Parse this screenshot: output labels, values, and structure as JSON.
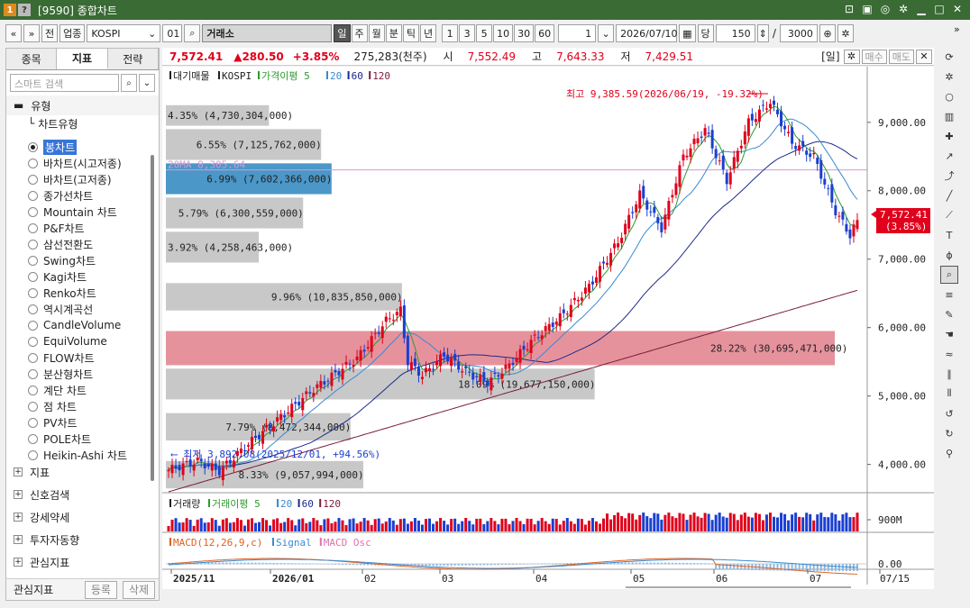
{
  "window": {
    "badge1": "1",
    "badge2": "?",
    "title": "[9590] 종합차트"
  },
  "toolbar": {
    "nav_prev": "«",
    "nav_down": "»",
    "btn_full": "전",
    "btn_sector": "업종",
    "symbol": "KOSPI",
    "code": "01",
    "market": "거래소",
    "periods": [
      "일",
      "주",
      "월",
      "분",
      "틱",
      "년"
    ],
    "selected_period": "일",
    "nums": [
      "1",
      "3",
      "5",
      "10",
      "30",
      "60"
    ],
    "interval": "1",
    "date": "2026/07/10",
    "btn_dang": "당",
    "count": "150",
    "slash": "/",
    "total": "3000"
  },
  "left_panel": {
    "tabs": [
      "종목",
      "지표",
      "전략"
    ],
    "active_tab": "지표",
    "search_placeholder": "스마트 검색",
    "tree_head": "유형",
    "tree_sub": "차트유형",
    "chart_types": [
      "봉차트",
      "바차트(시고저종)",
      "바차트(고저종)",
      "종가선차트",
      "Mountain 차트",
      "P&F차트",
      "삼선전환도",
      "Swing차트",
      "Kagi차트",
      "Renko차트",
      "역시계곡선",
      "CandleVolume",
      "EquiVolume",
      "FLOW차트",
      "분산형차트",
      "계단 차트",
      "점 차트",
      "PV차트",
      "POLE차트",
      "Heikin-Ashi 차트"
    ],
    "selected_type": "봉차트",
    "groups": [
      "지표",
      "신호검색",
      "강세약세",
      "투자자동향",
      "관심지표"
    ],
    "bottom_label": "관심지표",
    "btn_register": "등록",
    "btn_delete": "삭제"
  },
  "price_bar": {
    "price": "7,572.41",
    "change": "▲280.50",
    "pct": "+3.85%",
    "volume": "275,283(천주)",
    "open_label": "시",
    "open": "7,552.49",
    "high_label": "고",
    "high": "7,643.33",
    "low_label": "저",
    "low": "7,429.51",
    "period_tag": "[일]",
    "btn_buy": "매수",
    "btn_sell": "매도"
  },
  "chart_data": {
    "type": "candlestick",
    "legend": {
      "l1": "대기매물",
      "l2": "KOSPI",
      "l3": "가격이평 5",
      "l4": "20",
      "l5": "60",
      "l6": "120"
    },
    "y_ticks": [
      "9,000.00",
      "8,000.00",
      "7,000.00",
      "6,000.00",
      "5,000.00",
      "4,000.00"
    ],
    "y_range": [
      3600,
      9550
    ],
    "x_ticks": [
      "2025/11",
      "2026/01",
      "02",
      "03",
      "04",
      "05",
      "06",
      "07",
      "07/15"
    ],
    "last_price_label": "7,572.41",
    "last_pct_label": "(3.85%)",
    "high_annotation": "최고 9,385.59(2026/06/19, -19.32%)",
    "low_annotation": "최저 3,892.08(2025/12/01, +94.56%)",
    "ma_annotation": "20MA 8,305.64",
    "volume_profile": [
      {
        "label": "4.35% (4,730,304,000)",
        "pct": 4.35
      },
      {
        "label": "6.55% (7,125,762,000)",
        "pct": 6.55
      },
      {
        "label": "6.99% (7,602,366,000)",
        "pct": 6.99
      },
      {
        "label": "5.79% (6,300,559,000)",
        "pct": 5.79
      },
      {
        "label": "3.92% (4,258,463,000)",
        "pct": 3.92
      },
      {
        "label": "9.96% (10,835,850,000)",
        "pct": 9.96
      },
      {
        "label": "28.22% (30,695,471,000)",
        "pct": 28.22
      },
      {
        "label": "18.09% (19,677,150,000)",
        "pct": 18.09
      },
      {
        "label": "7.79% (8,472,344,000)",
        "pct": 7.79
      },
      {
        "label": "8.33% (9,057,994,000)",
        "pct": 8.33
      }
    ],
    "volume_legend": {
      "l1": "거래량",
      "l2": "거래이평 5",
      "l3": "20",
      "l4": "60",
      "l5": "120"
    },
    "volume_tick": "900M",
    "macd_legend": {
      "l1": "MACD(12,26,9,c)",
      "l2": "Signal",
      "l3": "MACD Osc"
    },
    "macd_tick": "0.00",
    "colors": {
      "up": "#e0001b",
      "down": "#1a3fd1",
      "ma5": "#2e9a2e",
      "ma20": "#3a8ad0",
      "ma60": "#1c2a8a",
      "ma120": "#7a1a3a"
    }
  },
  "right_icons": [
    "refresh-icon",
    "settings-icon",
    "circle-icon",
    "chart-icon",
    "crosshair-icon",
    "arrow-line-icon",
    "trend-icon",
    "line-icon",
    "auto-line-icon",
    "text-icon",
    "fib-icon",
    "zoom-icon",
    "magnet-icon",
    "draw-icon",
    "hand-icon",
    "wave-icon",
    "bars-icon",
    "bars2-icon",
    "undo-icon",
    "redo-icon",
    "search-icon"
  ]
}
